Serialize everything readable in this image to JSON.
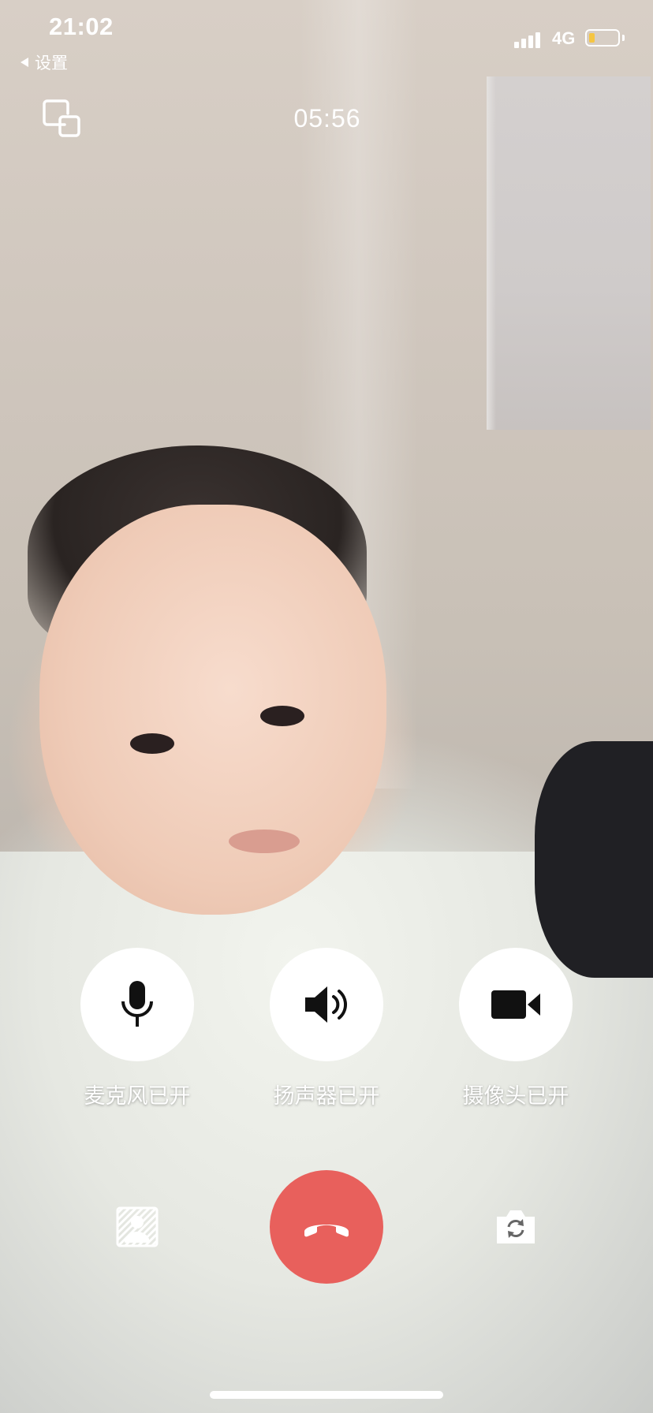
{
  "status_bar": {
    "time": "21:02",
    "network": "4G",
    "battery_level": 0.2,
    "battery_color": "#f5c542",
    "signal_bars": 4
  },
  "back_link": {
    "label": "设置",
    "icon": "back-triangle-icon"
  },
  "call": {
    "duration": "05:56"
  },
  "controls": {
    "microphone": {
      "label": "麦克风已开",
      "icon": "microphone-icon"
    },
    "speaker": {
      "label": "扬声器已开",
      "icon": "speaker-icon"
    },
    "camera": {
      "label": "摄像头已开",
      "icon": "video-camera-icon"
    }
  },
  "bottom_actions": {
    "blur_background": {
      "icon": "background-blur-icon"
    },
    "hang_up": {
      "icon": "phone-hangup-icon",
      "color": "#e8605c"
    },
    "switch_camera": {
      "icon": "camera-switch-icon"
    }
  }
}
